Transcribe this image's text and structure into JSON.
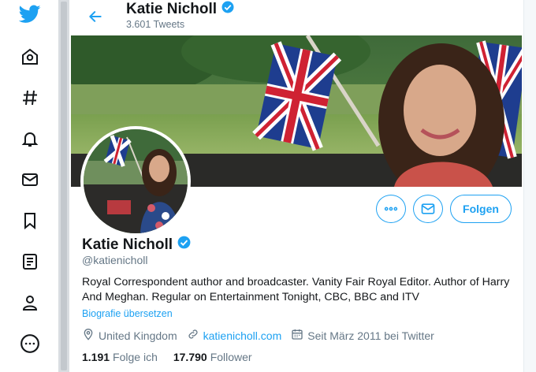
{
  "sidebar": {
    "items": [
      {
        "icon": "twitter-logo-icon"
      },
      {
        "icon": "home-icon"
      },
      {
        "icon": "hashtag-icon"
      },
      {
        "icon": "bell-icon"
      },
      {
        "icon": "mail-icon"
      },
      {
        "icon": "bookmark-icon"
      },
      {
        "icon": "list-icon"
      },
      {
        "icon": "profile-icon"
      },
      {
        "icon": "more-icon"
      }
    ]
  },
  "colors": {
    "accent": "#1da1f2",
    "text": "#14171a",
    "muted": "#657786"
  },
  "header": {
    "name": "Katie Nicholl",
    "tweet_count": "3.601 Tweets"
  },
  "profile": {
    "name": "Katie Nicholl",
    "handle": "@katienicholl",
    "bio": "Royal Correspondent author and broadcaster. Vanity Fair Royal Editor. Author of Harry And Meghan. Regular on Entertainment Tonight, CBC, BBC and ITV",
    "translate_label": "Biografie übersetzen",
    "location": "United Kingdom",
    "website": "katienicholl.com",
    "joined": "Seit März 2011 bei Twitter",
    "following_count": "1.191",
    "following_label": "Folge ich",
    "followers_count": "17.790",
    "followers_label": "Follower"
  },
  "actions": {
    "follow_label": "Folgen"
  }
}
